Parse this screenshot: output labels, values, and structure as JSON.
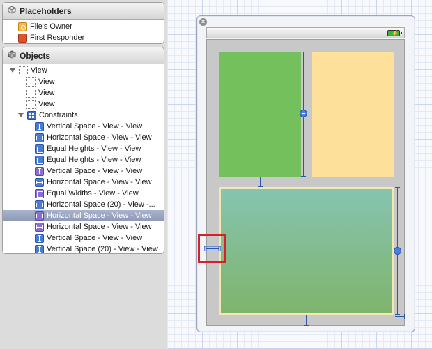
{
  "placeholders": {
    "title": "Placeholders",
    "items": [
      {
        "label": "File's Owner",
        "icon": "files-owner-icon"
      },
      {
        "label": "First Responder",
        "icon": "first-responder-icon"
      }
    ]
  },
  "objects": {
    "title": "Objects",
    "root": {
      "label": "View"
    },
    "subviews": [
      {
        "label": "View"
      },
      {
        "label": "View"
      },
      {
        "label": "View"
      }
    ],
    "constraints": {
      "label": "Constraints",
      "items": [
        {
          "label": "Vertical Space - View - View",
          "icon": "vertical-space-icon"
        },
        {
          "label": "Horizontal Space - View - View",
          "icon": "horizontal-space-icon"
        },
        {
          "label": "Equal Heights - View - View",
          "icon": "equal-heights-icon"
        },
        {
          "label": "Equal Heights - View - View",
          "icon": "equal-heights-icon"
        },
        {
          "label": "Vertical Space - View - View",
          "icon": "vertical-space-icon"
        },
        {
          "label": "Horizontal Space - View - View",
          "icon": "horizontal-space-icon"
        },
        {
          "label": "Equal Widths - View - View",
          "icon": "equal-widths-icon"
        },
        {
          "label": "Horizontal Space (20) - View -...",
          "icon": "horizontal-space-icon"
        },
        {
          "label": "Horizontal Space - View - View",
          "icon": "horizontal-space-icon",
          "selected": true
        },
        {
          "label": "Horizontal Space - View - View",
          "icon": "horizontal-space-icon"
        },
        {
          "label": "Vertical Space - View - View",
          "icon": "vertical-space-icon"
        },
        {
          "label": "Vertical Space (20) - View - View",
          "icon": "vertical-space-icon"
        }
      ]
    }
  },
  "canvas": {
    "close_glyph": "×",
    "battery_glyph": "⚡",
    "colors": {
      "green_view": "#73c05d",
      "yellow_view": "#fde09a",
      "teal_view": "#86c4b0",
      "constraint": "#2c56a8",
      "highlight": "#d8202a"
    }
  }
}
